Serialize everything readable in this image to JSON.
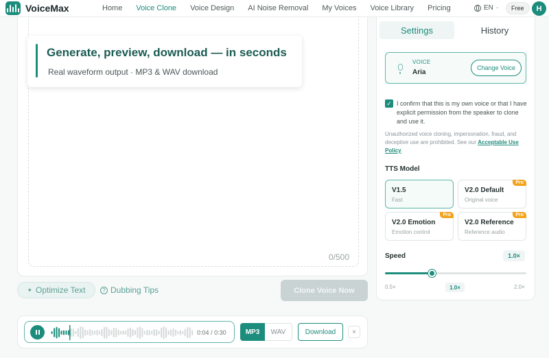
{
  "nav": {
    "brand": "VoiceMax",
    "links": [
      {
        "label": "Home",
        "active": false
      },
      {
        "label": "Voice Clone",
        "active": true
      },
      {
        "label": "Voice Design",
        "active": false
      },
      {
        "label": "AI Noise Removal",
        "active": false
      },
      {
        "label": "My Voices",
        "active": false
      },
      {
        "label": "Voice Library",
        "active": false
      },
      {
        "label": "Pricing",
        "active": false
      }
    ],
    "language": "EN",
    "language_caret": "·",
    "plan_badge": "Free",
    "avatar_initial": "H",
    "accent_color": "#1c8c7c"
  },
  "editor": {
    "promo_title": "Generate, preview, download — in seconds",
    "promo_subtitle": "Real waveform output · MP3 & WAV download",
    "char_counter": "0/500"
  },
  "actions": {
    "optimize_label": "Optimize Text",
    "dubbing_tips_label": "Dubbing Tips",
    "clone_label": "Clone Voice Now"
  },
  "player": {
    "elapsed": "0:04",
    "separator": "/",
    "duration": "0:30",
    "progress": 0.13,
    "formats": [
      "MP3",
      "WAV"
    ],
    "selected_format": "MP3",
    "download_label": "Download",
    "close_symbol": "×"
  },
  "settings": {
    "tabs": [
      {
        "label": "Settings",
        "active": true
      },
      {
        "label": "History",
        "active": false
      }
    ],
    "voice": {
      "label": "VOICE",
      "name": "Aria",
      "change_label": "Change Voice"
    },
    "consent": {
      "checked": true,
      "text": "I confirm that this is my own voice or that I have explicit permission from the speaker to clone and use it.",
      "warning_text": "Unauthorized voice cloning, impersonation, fraud, and deceptive use are prohibited. See our",
      "policy_link": "Acceptable Use Policy",
      "policy_suffix": "."
    },
    "tts_model": {
      "title": "TTS Model",
      "models": [
        {
          "name": "V1.5",
          "desc": "Fast",
          "pro": false,
          "selected": true
        },
        {
          "name": "V2.0 Default",
          "desc": "Original voice",
          "pro": true,
          "selected": false
        },
        {
          "name": "V2.0 Emotion",
          "desc": "Emotion control",
          "pro": true,
          "selected": false
        },
        {
          "name": "V2.0 Reference",
          "desc": "Reference audio",
          "pro": true,
          "selected": false
        }
      ],
      "pro_badge": "Pro"
    },
    "speed": {
      "title": "Speed",
      "value_label": "1.0×",
      "value": 1.0,
      "min": 0.5,
      "max": 2.0,
      "ticks": [
        "0.5×",
        "1.0×",
        "2.0×"
      ]
    }
  }
}
